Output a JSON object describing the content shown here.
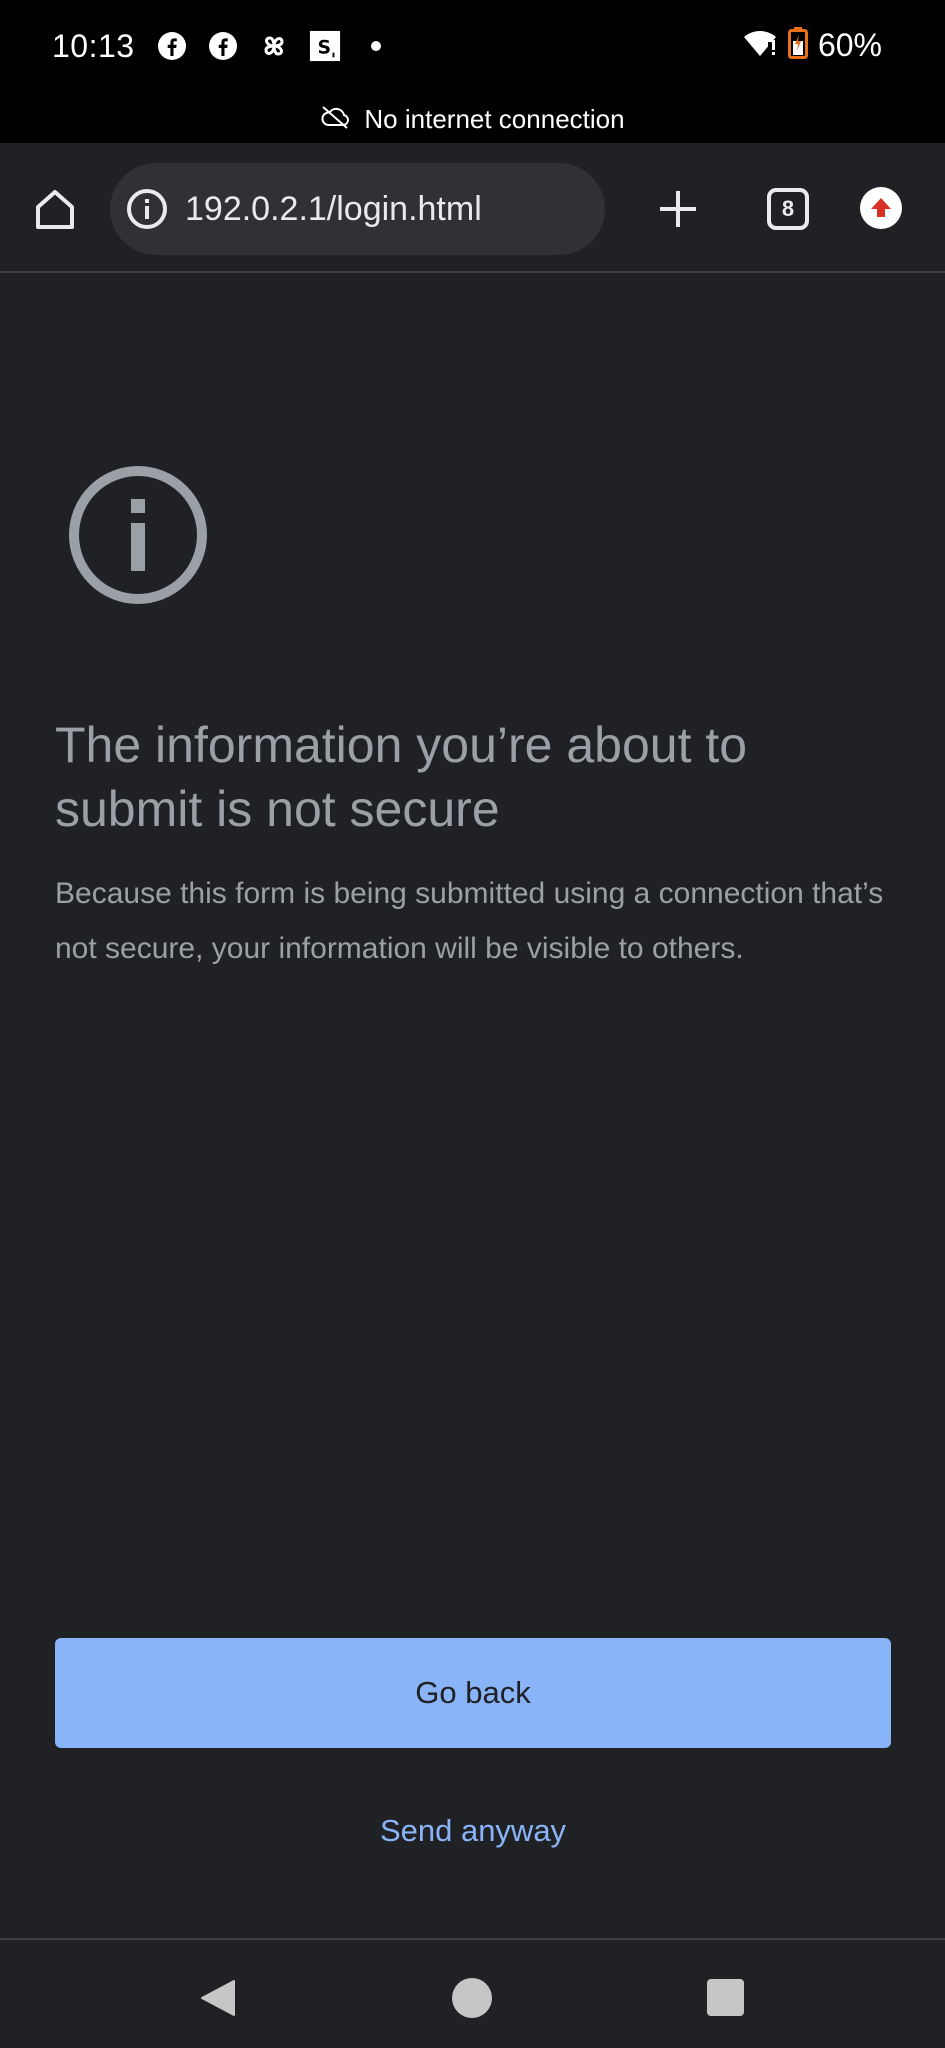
{
  "status_bar": {
    "time": "10:13",
    "battery": "60%",
    "notification_icons": [
      "facebook-icon",
      "facebook-icon",
      "pinwheel-icon",
      "s-app-icon",
      "dot-icon"
    ]
  },
  "offline_banner": {
    "text": "No internet connection"
  },
  "toolbar": {
    "url": "192.0.2.1/login.html",
    "tab_count": "8"
  },
  "dialog": {
    "heading": "The information you’re about to submit is not secure",
    "body": "Because this form is being submitted using a connection that’s not secure, your information will be visible to others.",
    "primary_button": "Go back",
    "secondary_button": "Send anyway"
  },
  "colors": {
    "background": "#202124",
    "accent": "#8ab4f8",
    "muted_text": "#9aa0a6"
  }
}
